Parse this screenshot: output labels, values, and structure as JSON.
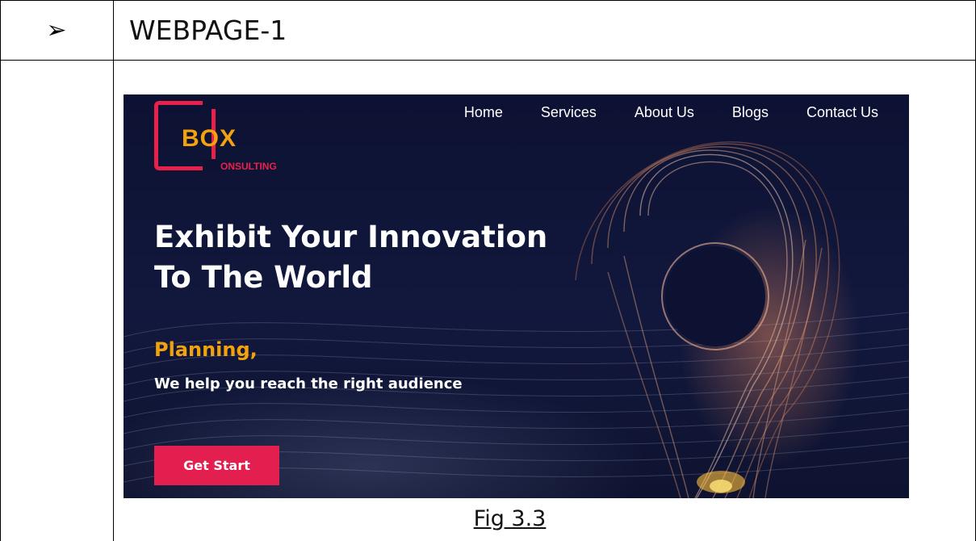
{
  "document": {
    "bullet_symbol": "➢",
    "section_title": "WEBPAGE-1",
    "figure_caption": "Fig 3.3"
  },
  "website": {
    "logo": {
      "word": "BOX",
      "sub": "ONSULTING",
      "colors": {
        "frame": "#e8214a",
        "word": "#f2a20c"
      }
    },
    "nav": [
      {
        "label": "Home"
      },
      {
        "label": "Services"
      },
      {
        "label": "About Us"
      },
      {
        "label": "Blogs"
      },
      {
        "label": "Contact Us"
      }
    ],
    "hero": {
      "title_line1": "Exhibit Your Innovation",
      "title_line2": "To The World",
      "kicker": "Planning,",
      "subtitle": "We help you reach the right audience",
      "cta_label": "Get Start"
    },
    "colors": {
      "background": "#0d1233",
      "accent": "#e31f4f",
      "highlight": "#f2a20c"
    },
    "background_art": "glowing-location-pin-icon"
  }
}
